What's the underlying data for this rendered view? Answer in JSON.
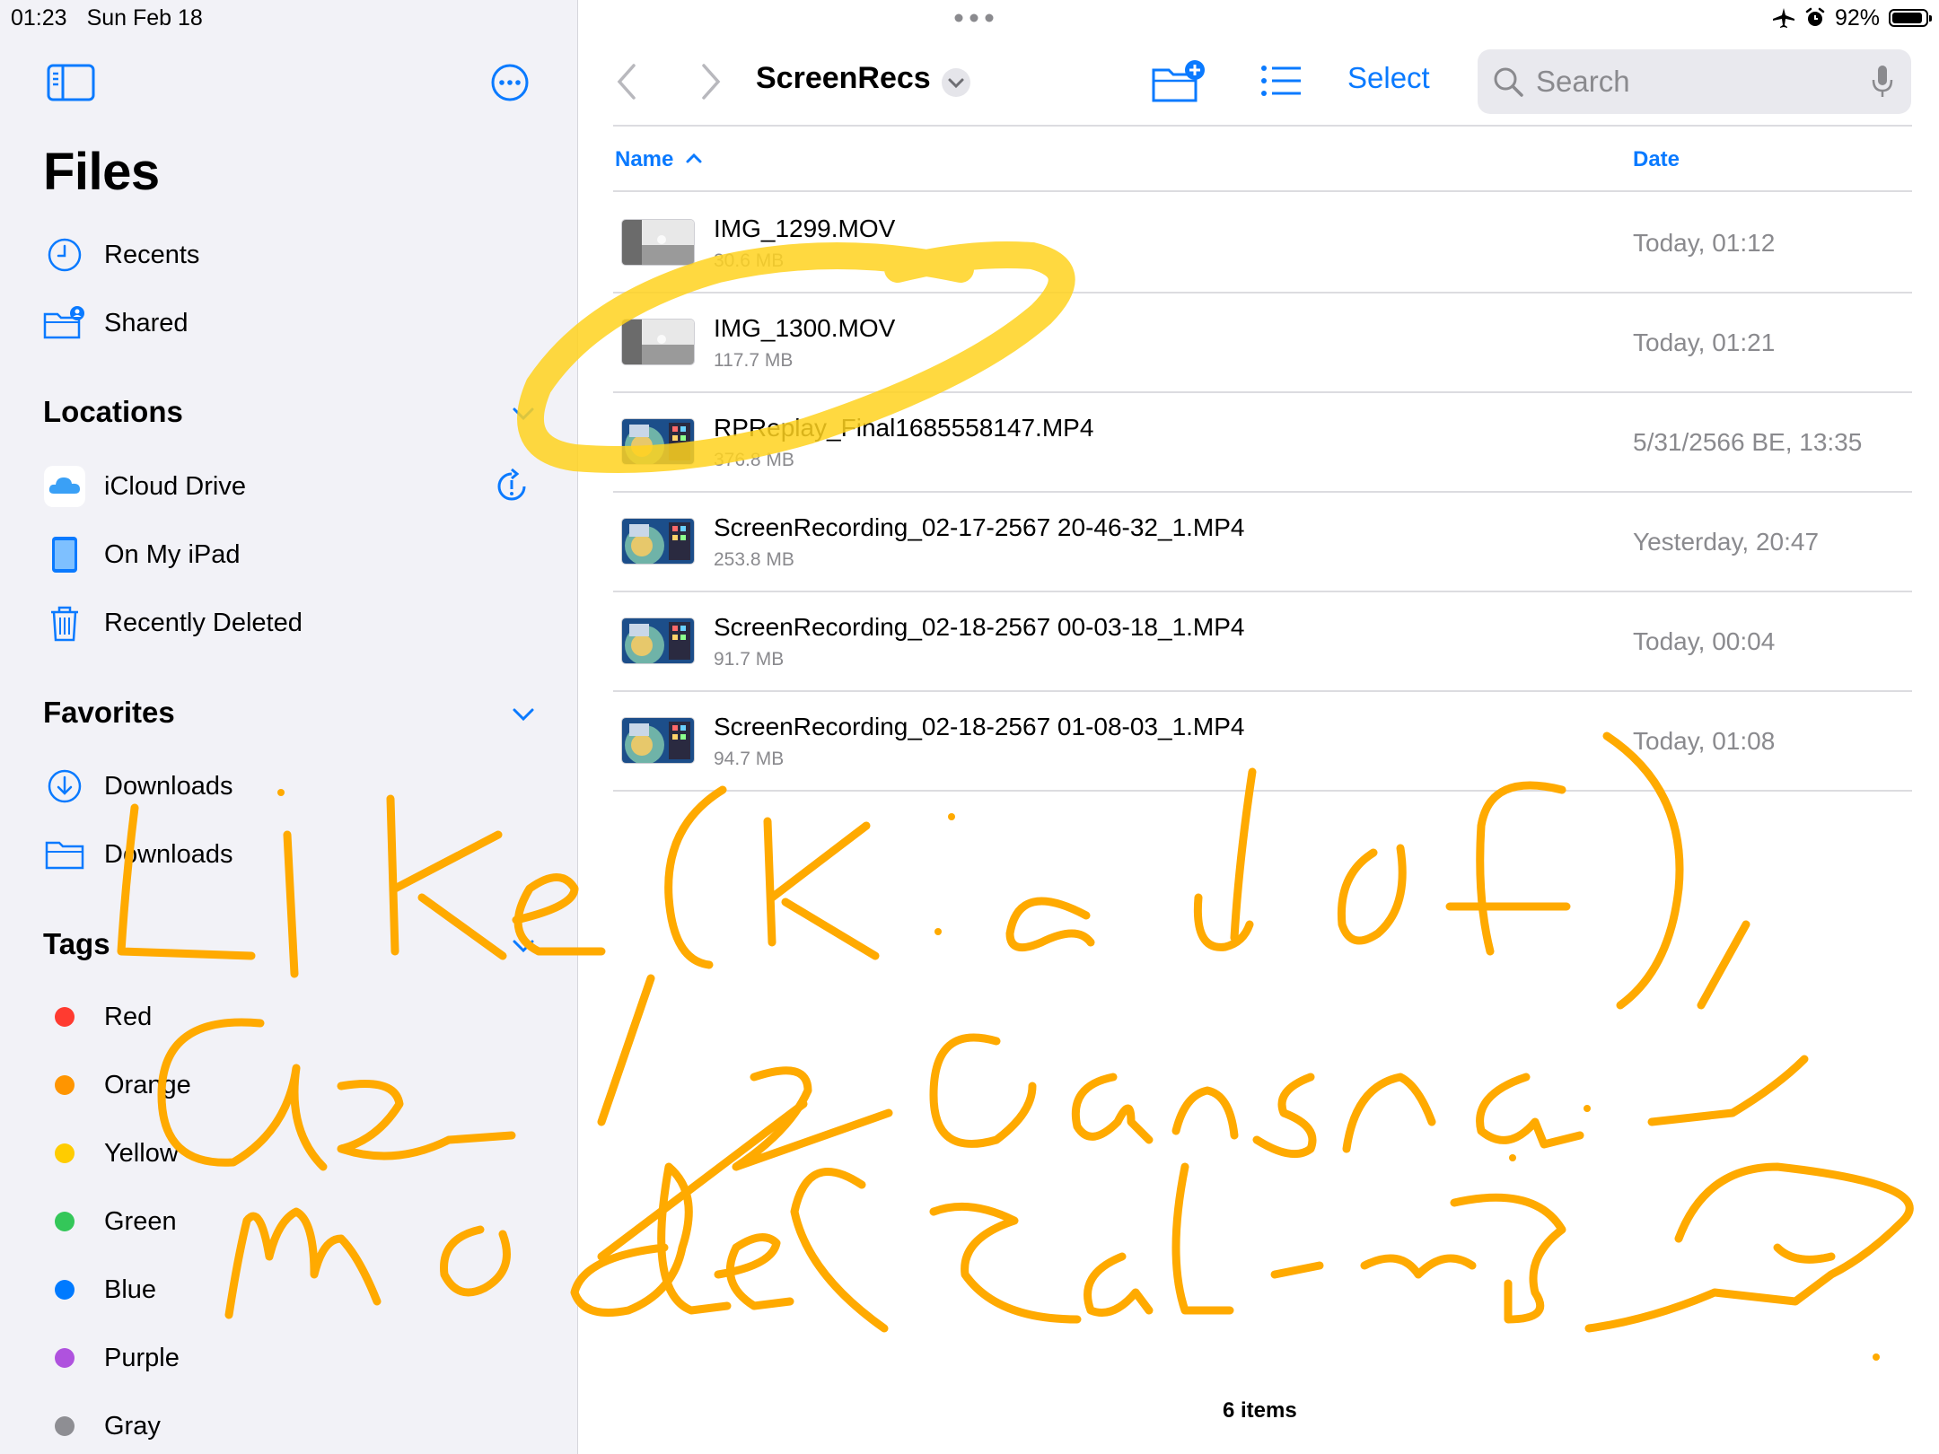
{
  "status_bar": {
    "time": "01:23",
    "date": "Sun Feb 18",
    "battery": "92%",
    "battery_level": 0.92
  },
  "sidebar": {
    "title": "Files",
    "top_items": [
      {
        "label": "Recents",
        "icon": "clock-icon"
      },
      {
        "label": "Shared",
        "icon": "shared-folder-icon"
      }
    ],
    "locations": {
      "heading": "Locations",
      "items": [
        {
          "label": "iCloud Drive",
          "icon": "icloud-icon"
        },
        {
          "label": "On My iPad",
          "icon": "ipad-icon"
        },
        {
          "label": "Recently Deleted",
          "icon": "trash-icon"
        }
      ]
    },
    "favorites": {
      "heading": "Favorites",
      "items": [
        {
          "label": "Downloads",
          "icon": "download-circle-icon"
        },
        {
          "label": "Downloads",
          "icon": "folder-icon"
        }
      ]
    },
    "tags": {
      "heading": "Tags",
      "items": [
        {
          "label": "Red",
          "color": "#ff3b30"
        },
        {
          "label": "Orange",
          "color": "#ff9500"
        },
        {
          "label": "Yellow",
          "color": "#ffcc00"
        },
        {
          "label": "Green",
          "color": "#34c759"
        },
        {
          "label": "Blue",
          "color": "#007aff"
        },
        {
          "label": "Purple",
          "color": "#af52de"
        },
        {
          "label": "Gray",
          "color": "#8e8e93"
        }
      ]
    }
  },
  "toolbar": {
    "folder_name": "ScreenRecs",
    "select_label": "Select",
    "search_placeholder": "Search"
  },
  "columns": {
    "name": "Name",
    "date": "Date"
  },
  "files": [
    {
      "name": "IMG_1299.MOV",
      "size": "30.6 MB",
      "date": "Today, 01:12",
      "thumb": "video"
    },
    {
      "name": "IMG_1300.MOV",
      "size": "117.7 MB",
      "date": "Today, 01:21",
      "thumb": "video"
    },
    {
      "name": "RPReplay_Final1685558147.MP4",
      "size": "376.8 MB",
      "date": "5/31/2566 BE, 13:35",
      "thumb": "screen"
    },
    {
      "name": "ScreenRecording_02-17-2567 20-46-32_1.MP4",
      "size": "253.8 MB",
      "date": "Yesterday, 20:47",
      "thumb": "screen"
    },
    {
      "name": "ScreenRecording_02-18-2567 00-03-18_1.MP4",
      "size": "91.7 MB",
      "date": "Today, 00:04",
      "thumb": "screen"
    },
    {
      "name": "ScreenRecording_02-18-2567 01-08-03_1.MP4",
      "size": "94.7 MB",
      "date": "Today, 01:08",
      "thumb": "screen"
    }
  ],
  "footer": {
    "items_count": "6 items"
  },
  "colors": {
    "accent": "#0a7aff",
    "highlighter": "#ffd21f",
    "handwriting": "#ffaa00"
  }
}
